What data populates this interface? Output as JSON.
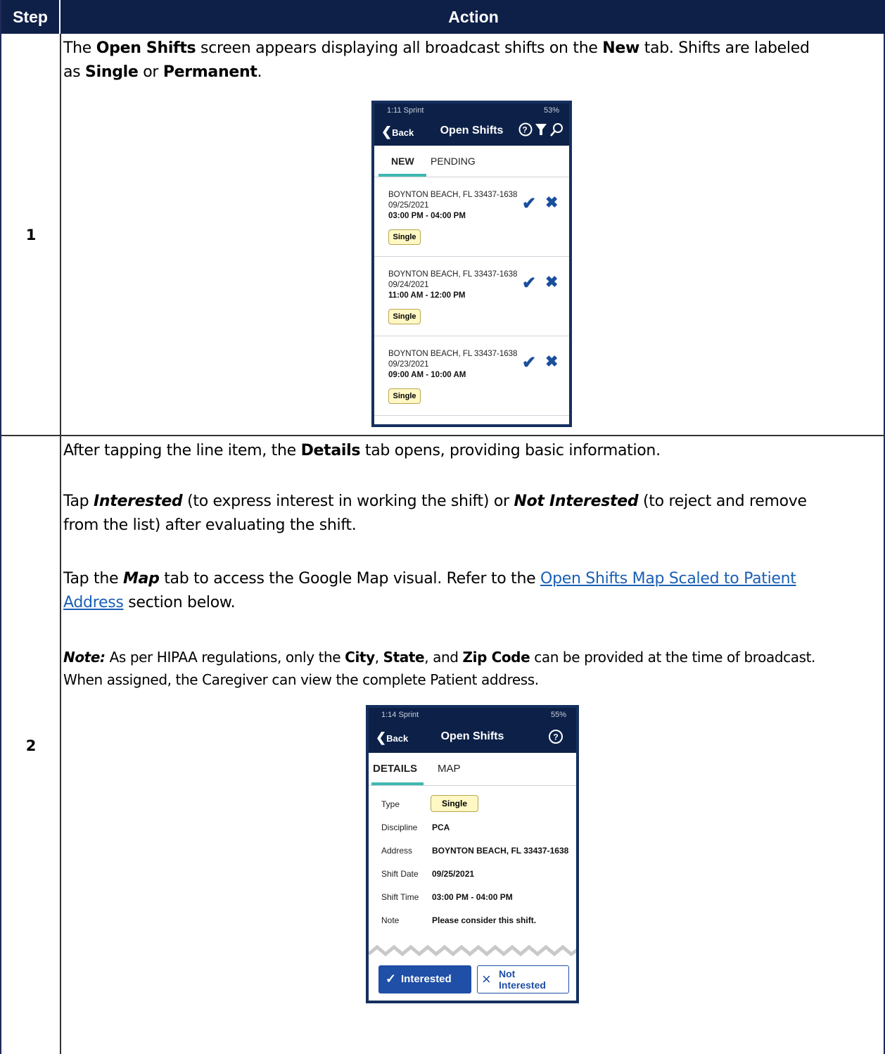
{
  "table": {
    "header_step": "Step",
    "header_action": "Action"
  },
  "row1": {
    "step": "1",
    "text": {
      "p1_a": "The ",
      "p1_b": "Open Shifts",
      "p1_c": " screen appears displaying all broadcast shifts on the ",
      "p1_d": "New",
      "p1_e": " tab. Shifts are labeled",
      "p2_a": "as ",
      "p2_b": "Single",
      "p2_c": " or ",
      "p2_d": "Permanent",
      "p2_e": "."
    },
    "phone": {
      "status_left": "1:11 Sprint",
      "status_right": "53%",
      "back": "Back",
      "title": "Open Shifts",
      "icons": "?▼⚲",
      "tab_new": "NEW",
      "tab_pending": "PENDING",
      "shifts": [
        {
          "address": "BOYNTON BEACH, FL 33437-1638",
          "date": "09/25/2021",
          "time": "03:00 PM - 04:00 PM",
          "type": "Single"
        },
        {
          "address": "BOYNTON BEACH, FL 33437-1638",
          "date": "09/24/2021",
          "time": "11:00 AM - 12:00 PM",
          "type": "Single"
        },
        {
          "address": "BOYNTON BEACH, FL 33437-1638",
          "date": "09/23/2021",
          "time": "09:00 AM - 10:00 AM",
          "type": "Single"
        }
      ]
    }
  },
  "row2": {
    "step": "2",
    "text": {
      "l1_a": "After tapping the line item, the ",
      "l1_b": "Details",
      "l1_c": " tab opens, providing basic information.",
      "l2_a": "Tap ",
      "l2_b": "Interested",
      "l2_c": " (to express interest in working the shift) or ",
      "l2_d": "Not Interested",
      "l2_e": " (to reject and remove",
      "l3": "from the list) after evaluating the shift.",
      "l4_a": "Tap the ",
      "l4_b": "Map",
      "l4_c": " tab to access the Google Map visual. Refer to the ",
      "l4_link": "Open Shifts Map Scaled to Patient",
      "l5_link": "Address",
      "l5_c": " section below.",
      "l6_a": "Note:",
      "l6_b": " As per HIPAA regulations, only the ",
      "l6_c": "City",
      "l6_d": ", ",
      "l6_e": "State",
      "l6_f": ", and ",
      "l6_g": "Zip Code",
      "l6_h": " can be provided at the time of broadcast.",
      "l7": "When assigned, the Caregiver can view the complete Patient address."
    },
    "phone": {
      "status_left": "1:14 Sprint",
      "status_right": "55%",
      "back": "Back",
      "title": "Open Shifts",
      "help_icon": "?",
      "tab_details": "DETAILS",
      "tab_map": "MAP",
      "rows": [
        {
          "label": "Type",
          "value": "Single"
        },
        {
          "label": "Discipline",
          "value": "PCA"
        },
        {
          "label": "Address",
          "value": "BOYNTON BEACH, FL 33437-1638"
        },
        {
          "label": "Shift Date",
          "value": "09/25/2021"
        },
        {
          "label": "Shift Time",
          "value": "03:00 PM - 04:00 PM"
        },
        {
          "label": "Note",
          "value": "Please consider this shift."
        }
      ],
      "btn_interested": "Interested",
      "btn_not_1": "Not",
      "btn_not_2": "Interested"
    }
  }
}
